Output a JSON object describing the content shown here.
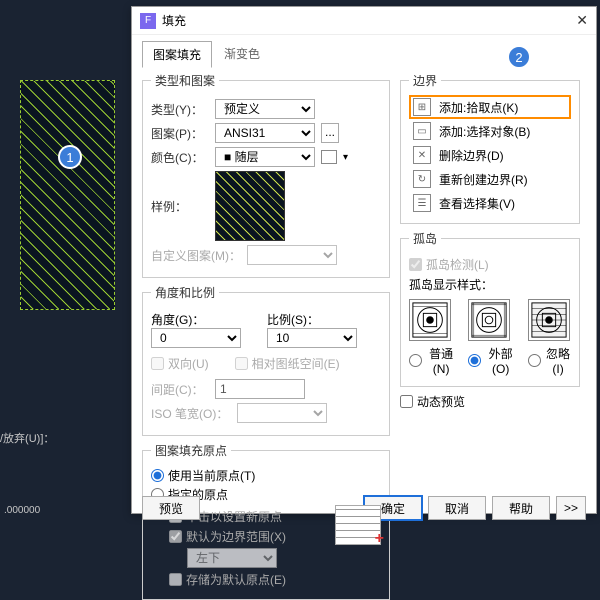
{
  "statusLine": "/放弃(U)]：",
  "statusNum": ".000000",
  "dialog": {
    "title": "填充"
  },
  "tabs": {
    "t1": "图案填充",
    "t2": "渐变色"
  },
  "typePattern": {
    "legend": "类型和图案",
    "typeLbl": "类型(Y)：",
    "typeVal": "预定义",
    "patternLbl": "图案(P)：",
    "patternVal": "ANSI31",
    "colorLbl": "颜色(C)：",
    "colorVal": "随层",
    "sampleLbl": "样例：",
    "customLbl": "自定义图案(M)："
  },
  "angleScale": {
    "legend": "角度和比例",
    "angleLbl": "角度(G)：",
    "angleVal": "0",
    "scaleLbl": "比例(S)：",
    "scaleVal": "10",
    "bidir": "双向(U)",
    "paper": "相对图纸空间(E)",
    "spacingLbl": "间距(C)：",
    "spacingVal": "1",
    "isoLbl": "ISO 笔宽(O)："
  },
  "origin": {
    "legend": "图案填充原点",
    "useCurrent": "使用当前原点(T)",
    "specify": "指定的原点",
    "clickNew": "单击以设置新原点",
    "defaultBound": "默认为边界范围(X)",
    "posVal": "左下",
    "store": "存储为默认原点(E)"
  },
  "boundary": {
    "legend": "边界",
    "addPick": "添加:拾取点(K)",
    "addSelect": "添加:选择对象(B)",
    "del": "删除边界(D)",
    "recreate": "重新创建边界(R)",
    "view": "查看选择集(V)"
  },
  "island": {
    "legend": "孤岛",
    "detect": "孤岛检测(L)",
    "styleLbl": "孤岛显示样式：",
    "normal": "普通(N)",
    "outer": "外部(O)",
    "ignore": "忽略(I)"
  },
  "dynPreview": "动态预览",
  "footer": {
    "preview": "预览",
    "ok": "确定",
    "cancel": "取消",
    "help": "帮助",
    "more": ">>"
  }
}
